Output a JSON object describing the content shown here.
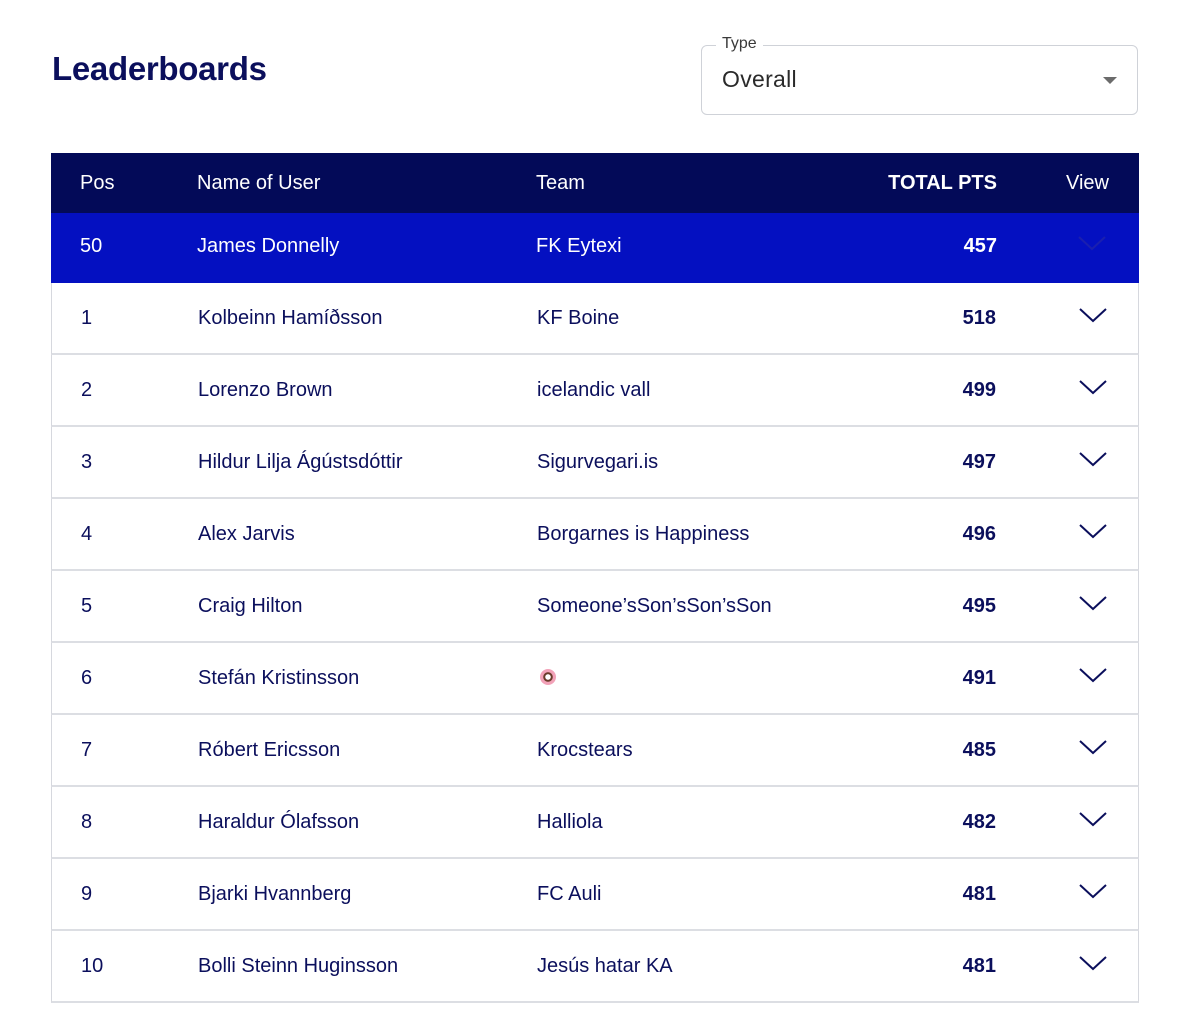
{
  "page": {
    "title": "Leaderboards"
  },
  "type_select": {
    "label": "Type",
    "value": "Overall"
  },
  "table": {
    "headers": {
      "pos": "Pos",
      "name": "Name of User",
      "team": "Team",
      "total_pts": "TOTAL PTS",
      "view": "View"
    },
    "user_row": {
      "pos": "50",
      "name": "James Donnelly",
      "team": "FK Eytexi",
      "points": "457"
    },
    "rows": [
      {
        "pos": "1",
        "name": "Kolbeinn Hamíðsson",
        "team": "KF Boine",
        "points": "518"
      },
      {
        "pos": "2",
        "name": "Lorenzo Brown",
        "team": "icelandic vall",
        "points": "499"
      },
      {
        "pos": "3",
        "name": "Hildur Lilja Ágústsdóttir",
        "team": "Sigurvegari.is",
        "points": "497"
      },
      {
        "pos": "4",
        "name": "Alex Jarvis",
        "team": "Borgarnes is Happiness",
        "points": "496"
      },
      {
        "pos": "5",
        "name": "Craig Hilton",
        "team": "Someone’sSon’sSon’sSon",
        "points": "495"
      },
      {
        "pos": "6",
        "name": "Stefán Kristinsson",
        "team": "",
        "team_icon": "donut-emoji",
        "points": "491"
      },
      {
        "pos": "7",
        "name": "Róbert Ericsson",
        "team": "Krocstears",
        "points": "485"
      },
      {
        "pos": "8",
        "name": "Haraldur Ólafsson",
        "team": "Halliola",
        "points": "482"
      },
      {
        "pos": "9",
        "name": "Bjarki Hvannberg",
        "team": "FC Auli",
        "points": "481"
      },
      {
        "pos": "10",
        "name": "Bolli Steinn Huginsson",
        "team": "Jesús hatar KA",
        "points": "481"
      }
    ]
  },
  "colors": {
    "header_bg": "#030a58",
    "highlight_bg": "#0410c1",
    "text_navy": "#0b0f5c"
  }
}
